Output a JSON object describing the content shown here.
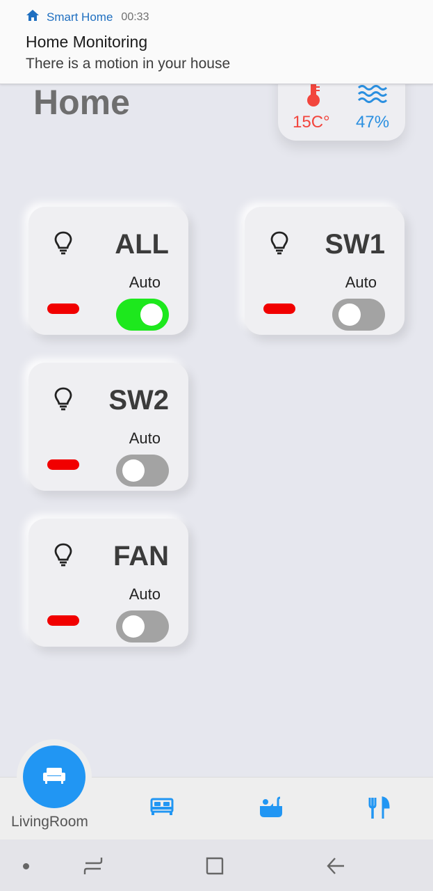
{
  "notification": {
    "app_name": "Smart Home",
    "time": "00:33",
    "title": "Home Monitoring",
    "text": "There is a motion in your house",
    "icon": "home-icon",
    "accent": "#1f6fc0"
  },
  "header": {
    "title": "Home"
  },
  "climate": {
    "temperature": "15C°",
    "humidity": "47%",
    "temperature_color": "#f2453d",
    "humidity_color": "#2a8fe0",
    "temperature_icon": "thermometer-icon",
    "humidity_icon": "water-waves-icon"
  },
  "cards": [
    {
      "name": "ALL",
      "mode": "Auto",
      "switch_on": true,
      "icon": "lightbulb-icon",
      "indicator_color": "#f10000"
    },
    {
      "name": "SW1",
      "mode": "Auto",
      "switch_on": false,
      "icon": "lightbulb-icon",
      "indicator_color": "#f10000"
    },
    {
      "name": "SW2",
      "mode": "Auto",
      "switch_on": false,
      "icon": "lightbulb-icon",
      "indicator_color": "#f10000"
    },
    {
      "name": "FAN",
      "mode": "Auto",
      "switch_on": false,
      "icon": "lightbulb-icon",
      "indicator_color": "#f10000"
    }
  ],
  "bottom_nav": {
    "active_label": "LivingRoom",
    "active_icon": "sofa-icon",
    "items": [
      {
        "icon": "bed-icon"
      },
      {
        "icon": "bathtub-icon"
      },
      {
        "icon": "fork-knife-icon"
      }
    ],
    "accent": "#2196f3"
  },
  "system_nav": {
    "icons": [
      "recents-icon",
      "home-square-icon",
      "back-icon"
    ]
  }
}
